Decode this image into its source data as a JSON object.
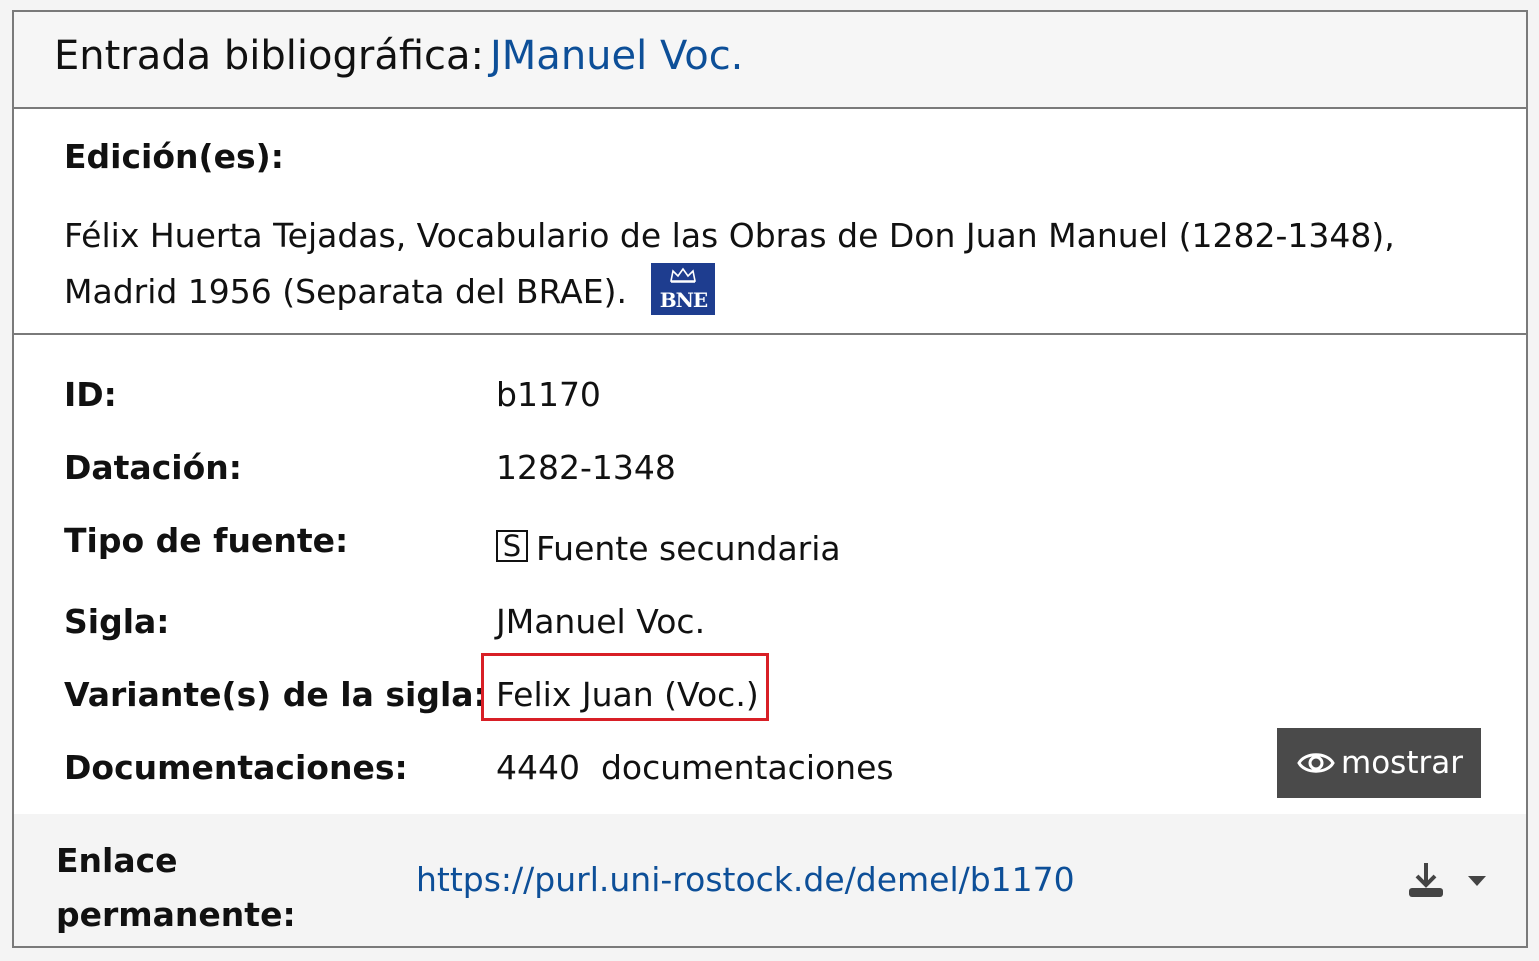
{
  "header": {
    "label": "Entrada bibliográfica:",
    "value": "JManuel Voc."
  },
  "edition": {
    "title": "Edición(es):",
    "text": "Félix Huerta Tejadas, Vocabulario de las Obras de Don Juan Manuel (1282-1348), Madrid 1956 (Separata del BRAE).",
    "logo_text": "BNE",
    "logo_color": "#1e3d8f"
  },
  "details": [
    {
      "label": "ID:",
      "value": "b1170"
    },
    {
      "label": "Datación:",
      "value": "1282-1348"
    },
    {
      "label": "Tipo de fuente:",
      "badge": "S",
      "value": "Fuente secundaria"
    },
    {
      "label": "Sigla:",
      "value": "JManuel Voc."
    },
    {
      "label": "Variante(s) de la sigla:",
      "value": "Felix Juan (Voc.)"
    },
    {
      "label": "Documentaciones:",
      "value": "4440  documentaciones"
    }
  ],
  "show_button": {
    "label": "mostrar",
    "icon": "eye-icon"
  },
  "footer": {
    "label": "Enlace permanente:",
    "link": "https://purl.uni-rostock.de/demel/b1170",
    "download_icon": "download-icon"
  },
  "colors": {
    "link": "#0d4f98",
    "highlight": "#d81f26",
    "button_bg": "#4a4a4a"
  }
}
